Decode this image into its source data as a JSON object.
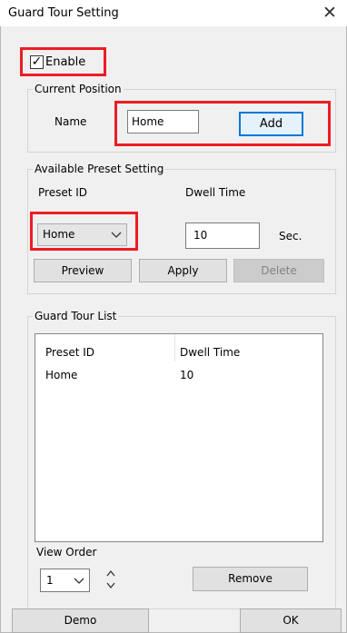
{
  "window": {
    "title": "Guard Tour Setting",
    "close_glyph": "✕"
  },
  "enable": {
    "label": "Enable",
    "checked": true,
    "check_glyph": "✓"
  },
  "current_position": {
    "legend": "Current Position",
    "name_label": "Name",
    "name_value": "Home",
    "add_label": "Add"
  },
  "preset_setting": {
    "legend": "Available Preset Setting",
    "preset_id_label": "Preset ID",
    "dwell_time_label": "Dwell Time",
    "preset_selected": "Home",
    "dwell_value": "10",
    "unit": "Sec.",
    "preview_label": "Preview",
    "apply_label": "Apply",
    "delete_label": "Delete"
  },
  "guard_tour_list": {
    "legend": "Guard Tour List",
    "columns": [
      "Preset ID",
      "Dwell Time"
    ],
    "rows": [
      {
        "preset_id": "Home",
        "dwell_time": "10"
      }
    ]
  },
  "view_order": {
    "label": "View Order",
    "selected": "1",
    "remove_label": "Remove"
  },
  "footer": {
    "demo_label": "Demo",
    "ok_label": "OK"
  },
  "colors": {
    "highlight": "#ed1c24",
    "accent": "#0078d7",
    "window_bg": "#f0f0f0"
  },
  "icons": [
    "close-icon",
    "checkmark-icon",
    "chevron-down-icon",
    "chevron-up-icon"
  ]
}
